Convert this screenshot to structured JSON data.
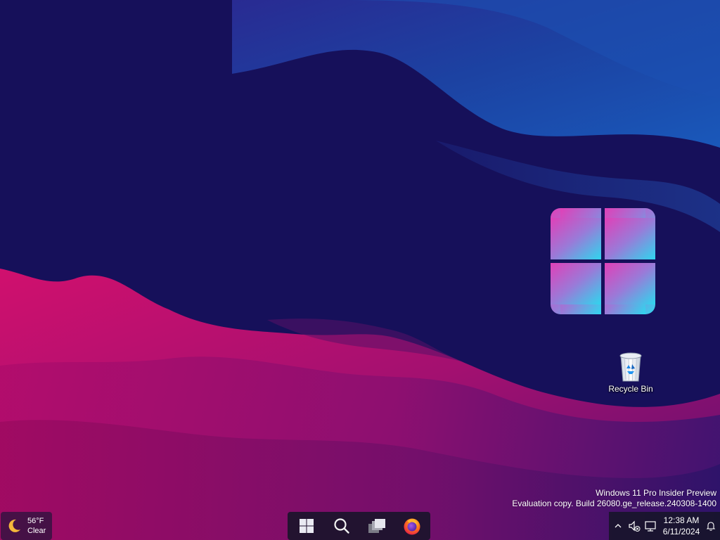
{
  "desktop": {
    "icons": [
      {
        "label": "Recycle Bin",
        "icon": "recycle-bin-icon"
      }
    ]
  },
  "watermark": {
    "line1": "Windows 11 Pro Insider Preview",
    "line2": "Evaluation copy. Build 26080.ge_release.240308-1400"
  },
  "taskbar": {
    "weather": {
      "icon": "moon-icon",
      "temperature": "56°F",
      "condition": "Clear"
    },
    "pinned": [
      {
        "name": "Start",
        "icon": "windows-start-icon"
      },
      {
        "name": "Search",
        "icon": "search-icon"
      },
      {
        "name": "Task View",
        "icon": "task-view-icon"
      },
      {
        "name": "Firefox",
        "icon": "firefox-icon"
      }
    ],
    "tray": {
      "icons": [
        "chevron-up-icon",
        "speaker-muted-icon",
        "network-icon",
        "notification-bell-icon"
      ],
      "time": "12:38 AM",
      "date": "6/11/2024"
    }
  },
  "colors": {
    "wallpaper_dark": "#16105a",
    "wallpaper_blue": "#1e4aa8",
    "wallpaper_magenta": "#c0106e",
    "taskbar_bg": "#16142a"
  }
}
